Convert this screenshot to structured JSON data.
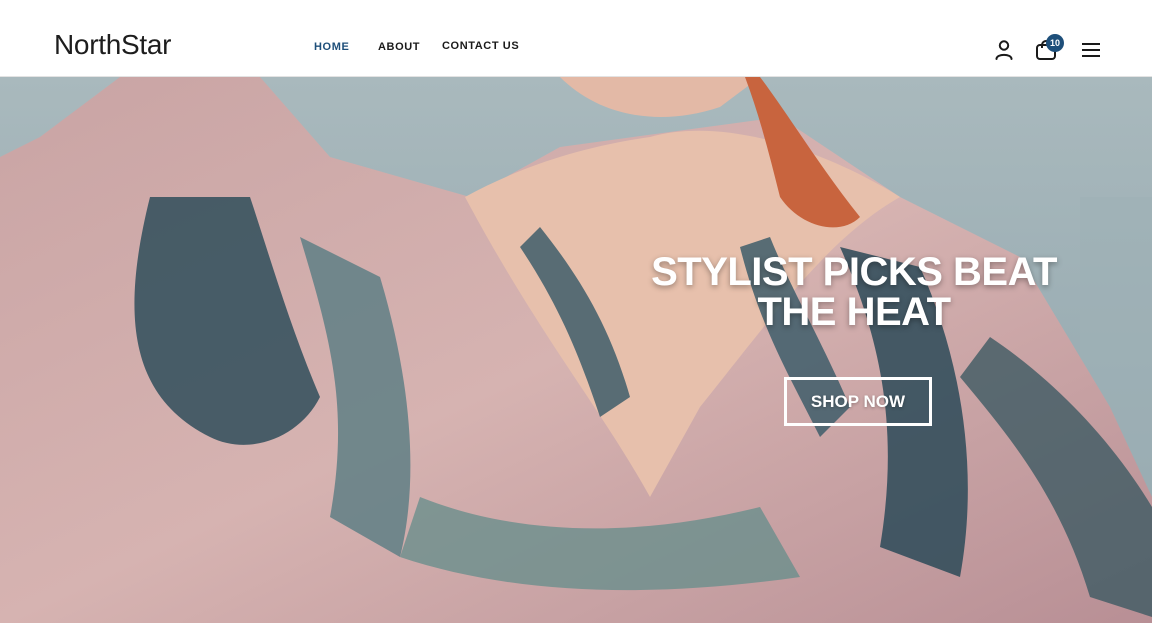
{
  "brand": {
    "name": "NorthStar"
  },
  "nav": {
    "items": [
      {
        "label": "HOME",
        "active": true
      },
      {
        "label": "ABOUT",
        "active": false
      },
      {
        "label": "CONTACT US",
        "active": false
      }
    ]
  },
  "header_actions": {
    "account_icon": "person-icon",
    "cart_icon": "shopping-bag-icon",
    "cart_count": "10",
    "menu_icon": "hamburger-menu-icon"
  },
  "hero": {
    "title": "STYLIST PICKS BEAT THE HEAT",
    "cta_label": "SHOP NOW",
    "image_subject": "woman-in-patterned-blouse-photo"
  },
  "colors": {
    "accent": "#1e4f7a",
    "text": "#1a1a1a",
    "background": "#ffffff",
    "hero_text": "#ffffff"
  }
}
